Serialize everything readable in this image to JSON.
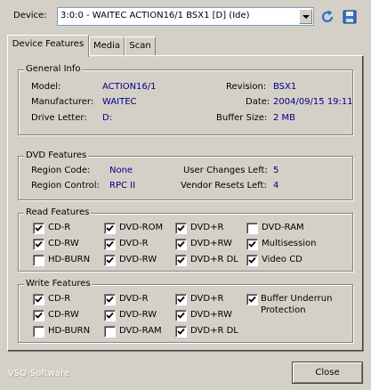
{
  "device": {
    "label": "Device:",
    "selected": "3:0:0 - WAITEC ACTION16/1 BSX1 [D] (Ide)",
    "icons": [
      "refresh-icon",
      "save-icon"
    ]
  },
  "tabs": [
    {
      "label": "Device Features",
      "active": true
    },
    {
      "label": "Media",
      "active": false
    },
    {
      "label": "Scan",
      "active": false
    }
  ],
  "general": {
    "title": "General Info",
    "model_label": "Model:",
    "model": "ACTION16/1",
    "manufacturer_label": "Manufacturer:",
    "manufacturer": "WAITEC",
    "drive_label": "Drive Letter:",
    "drive": "D:",
    "revision_label": "Revision:",
    "revision": "BSX1",
    "date_label": "Date:",
    "date": "2004/09/15 19:11",
    "buffer_label": "Buffer Size:",
    "buffer": "2 MB"
  },
  "dvd": {
    "title": "DVD Features",
    "region_code_label": "Region Code:",
    "region_code": "None",
    "region_control_label": "Region Control:",
    "region_control": "RPC II",
    "user_changes_label": "User Changes Left:",
    "user_changes": "5",
    "vendor_resets_label": "Vendor Resets Left:",
    "vendor_resets": "4"
  },
  "read": {
    "title": "Read Features",
    "items": [
      {
        "label": "CD-R",
        "checked": true
      },
      {
        "label": "DVD-ROM",
        "checked": true
      },
      {
        "label": "DVD+R",
        "checked": true
      },
      {
        "label": "DVD-RAM",
        "checked": false
      },
      {
        "label": "CD-RW",
        "checked": true
      },
      {
        "label": "DVD-R",
        "checked": true
      },
      {
        "label": "DVD+RW",
        "checked": true
      },
      {
        "label": "Multisession",
        "checked": true
      },
      {
        "label": "HD-BURN",
        "checked": false
      },
      {
        "label": "DVD-RW",
        "checked": true
      },
      {
        "label": "DVD+R DL",
        "checked": true
      },
      {
        "label": "Video CD",
        "checked": true
      }
    ]
  },
  "write": {
    "title": "Write Features",
    "items": [
      {
        "label": "CD-R",
        "checked": true
      },
      {
        "label": "DVD-R",
        "checked": true
      },
      {
        "label": "DVD+R",
        "checked": true
      },
      {
        "label": "CD-RW",
        "checked": true
      },
      {
        "label": "DVD-RW",
        "checked": true
      },
      {
        "label": "DVD+RW",
        "checked": true
      },
      {
        "label": "HD-BURN",
        "checked": false
      },
      {
        "label": "DVD-RAM",
        "checked": false
      },
      {
        "label": "DVD+R DL",
        "checked": true
      }
    ],
    "buffer_underrun": {
      "label_line1": "Buffer Underrun",
      "label_line2": "Protection",
      "checked": true
    }
  },
  "footer": {
    "brand": "VSO-Software",
    "close_label": "Close"
  }
}
